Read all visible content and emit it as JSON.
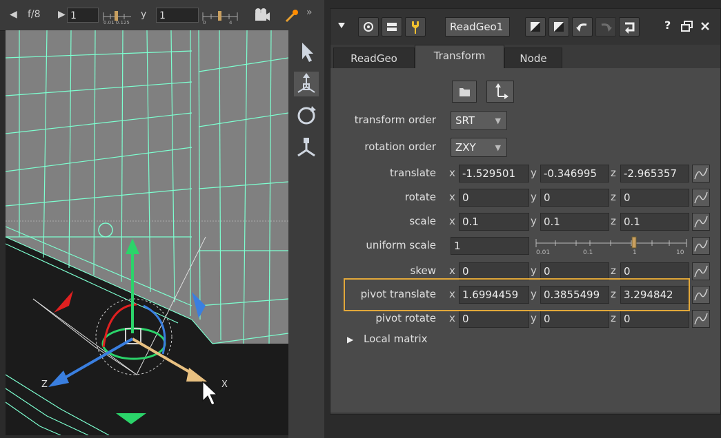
{
  "viewer": {
    "frame_label": "f/8",
    "frame_value": "1",
    "y_label": "y",
    "y_value": "1",
    "slider_ticks_1": "0.01 0.125",
    "slider_ticks_2": "0",
    "slider_ticks_3": "4",
    "gizmo_x_label": "X",
    "gizmo_z_label": "Z"
  },
  "panel": {
    "node_name": "ReadGeo1",
    "node_name_shown": "ReadGeo1",
    "help_label": "?",
    "tabs": [
      "ReadGeo",
      "Transform",
      "Node"
    ],
    "active_tab": "Transform",
    "transform_order": {
      "label": "transform order",
      "value": "SRT"
    },
    "rotation_order": {
      "label": "rotation order",
      "value": "ZXY"
    },
    "translate": {
      "label": "translate",
      "x": "-1.529501",
      "y": "-0.346995",
      "z": "-2.965357"
    },
    "rotate": {
      "label": "rotate",
      "x": "0",
      "y": "0",
      "z": "0"
    },
    "scale": {
      "label": "scale",
      "x": "0.1",
      "y": "0.1",
      "z": "0.1"
    },
    "uniform_scale": {
      "label": "uniform scale",
      "value": "1",
      "slider_ticks": [
        "0.01",
        "0.1",
        "1",
        "10"
      ],
      "slider_level": 1
    },
    "skew": {
      "label": "skew",
      "x": "0",
      "y": "0",
      "z": "0"
    },
    "pivot_translate": {
      "label": "pivot translate",
      "x": "1.6994459",
      "y": "0.3855499",
      "z": "3.294842"
    },
    "pivot_rotate": {
      "label": "pivot rotate",
      "x": "0",
      "y": "0",
      "z": "0"
    },
    "local_matrix_label": "Local matrix",
    "axis_labels": {
      "x": "x",
      "y": "y",
      "z": "z"
    }
  },
  "colors": {
    "wire": "#7dffd0",
    "highlight": "#e2a83a",
    "axis_x": "#e8c080",
    "axis_y": "#2bd46a",
    "axis_z": "#3a7fe0",
    "red_handle": "#e02020"
  }
}
